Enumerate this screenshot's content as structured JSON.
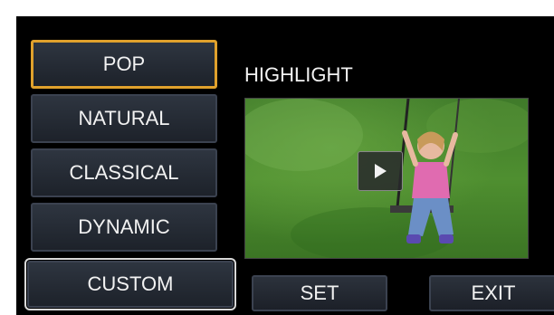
{
  "menu": {
    "items": [
      {
        "label": "POP",
        "selected": true
      },
      {
        "label": "NATURAL",
        "selected": false
      },
      {
        "label": "CLASSICAL",
        "selected": false
      },
      {
        "label": "DYNAMIC",
        "selected": false
      },
      {
        "label": "CUSTOM",
        "selected": false
      }
    ]
  },
  "preview": {
    "title": "HIGHLIGHT",
    "play_icon": "play-icon"
  },
  "bottom_bar": {
    "set_label": "SET",
    "exit_label": "EXIT"
  },
  "colors": {
    "selected_border": "#e0a12c",
    "focus_outline": "#d8d8d8",
    "screen_background": "#000000"
  }
}
